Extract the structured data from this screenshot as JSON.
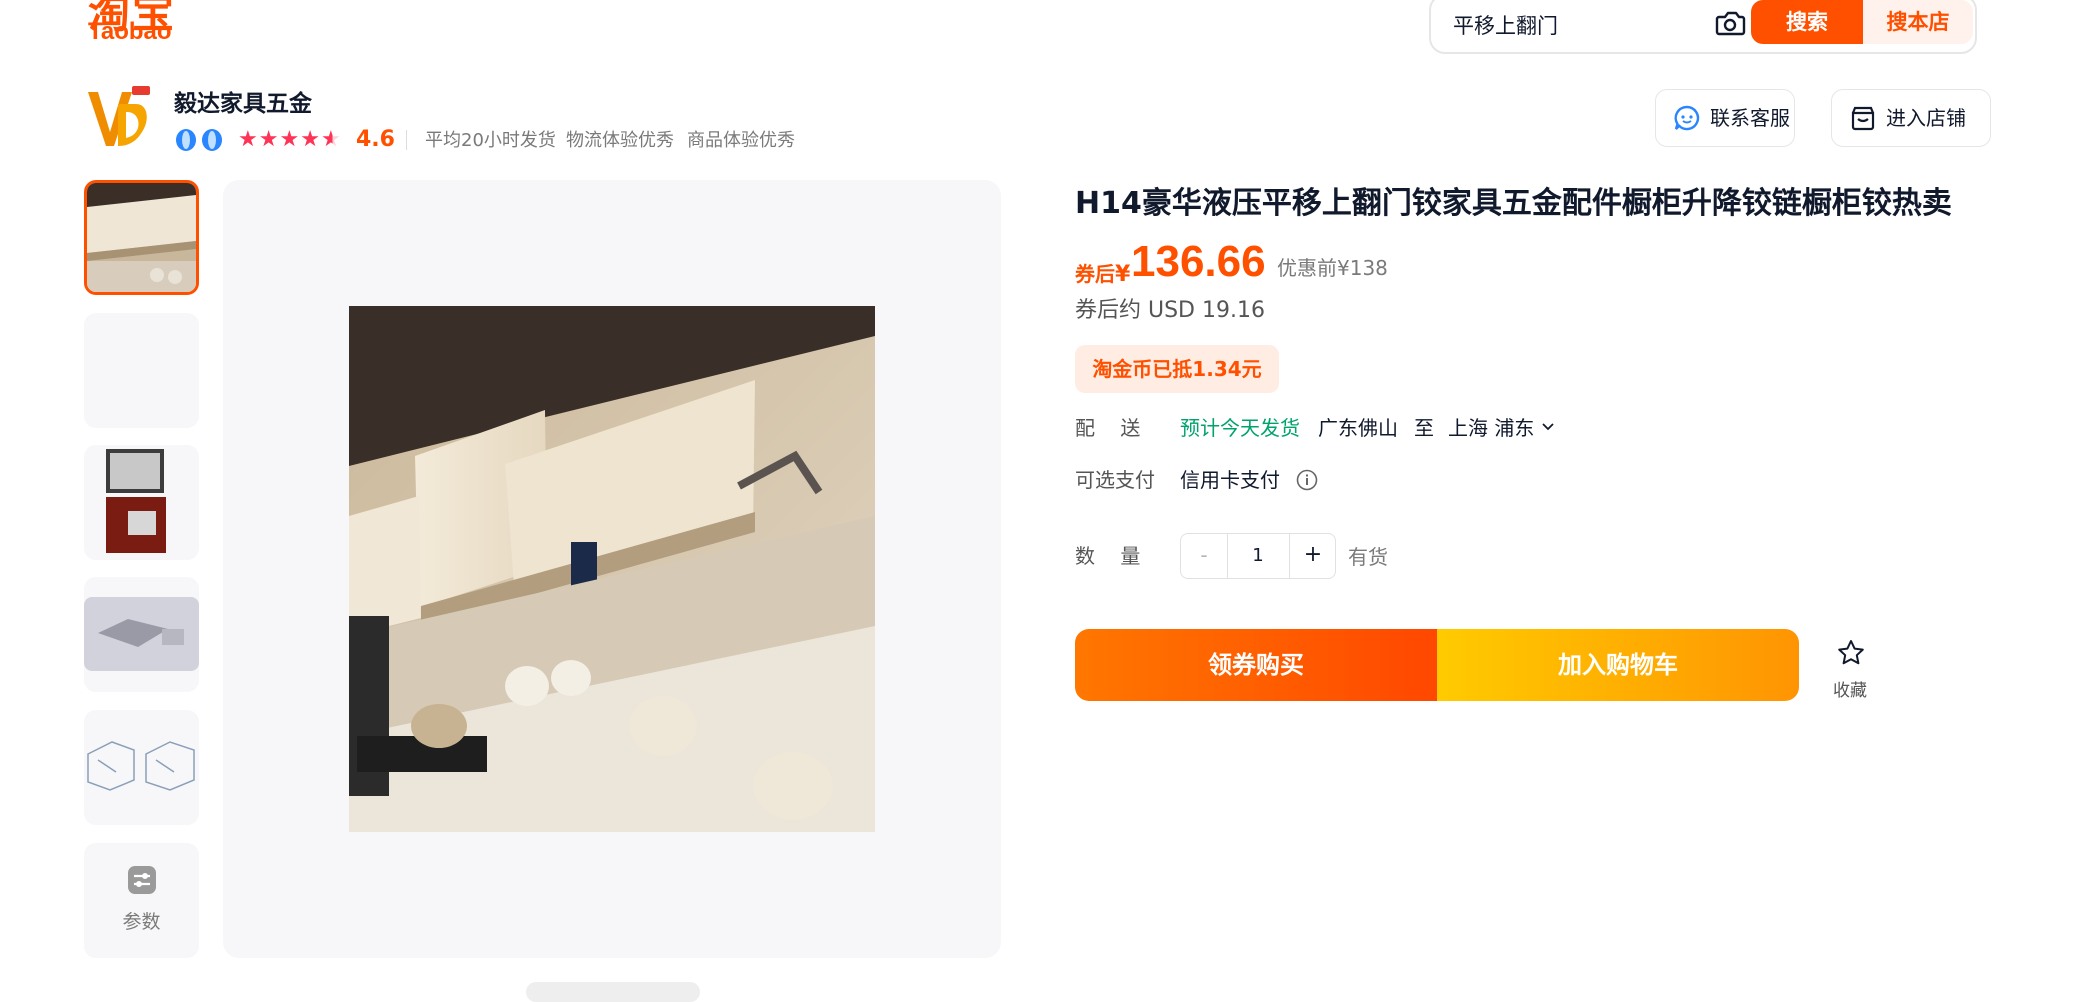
{
  "brand": {
    "logo_cn": "淘宝",
    "logo_en": "Taobao",
    "color": "#ff5000"
  },
  "search": {
    "value": "平移上翻门",
    "search_label": "搜索",
    "search_store_label": "搜本店",
    "camera_icon": "camera-icon"
  },
  "shop": {
    "name": "毅达家具五金",
    "rating": "4.6",
    "stars": 4.5,
    "services": [
      "平均20小时发货",
      "物流体验优秀",
      "商品体验优秀"
    ],
    "customer_service_label": "联系客服",
    "enter_store_label": "进入店铺"
  },
  "gallery": {
    "params_label": "参数"
  },
  "product": {
    "title": "H14豪华液压平移上翻门铰家具五金配件橱柜升降铰链橱柜铰热卖",
    "coupon_prefix": "券后",
    "currency": "¥",
    "price": "136.66",
    "original_price": "优惠前¥138",
    "usd_price": "券后约 USD 19.16",
    "coin_discount": "淘金币已抵1.34元",
    "delivery": {
      "label": "配    送",
      "eta": "预计今天发货",
      "from": "广东佛山",
      "to_word": "至",
      "to": "上海 浦东"
    },
    "payment": {
      "label": "可选支付",
      "method": "信用卡支付"
    },
    "quantity": {
      "label": "数    量",
      "minus": "-",
      "value": "1",
      "plus": "+",
      "stock": "有货"
    },
    "buy_label": "领券购买",
    "cart_label": "加入购物车",
    "favorite_label": "收藏"
  }
}
